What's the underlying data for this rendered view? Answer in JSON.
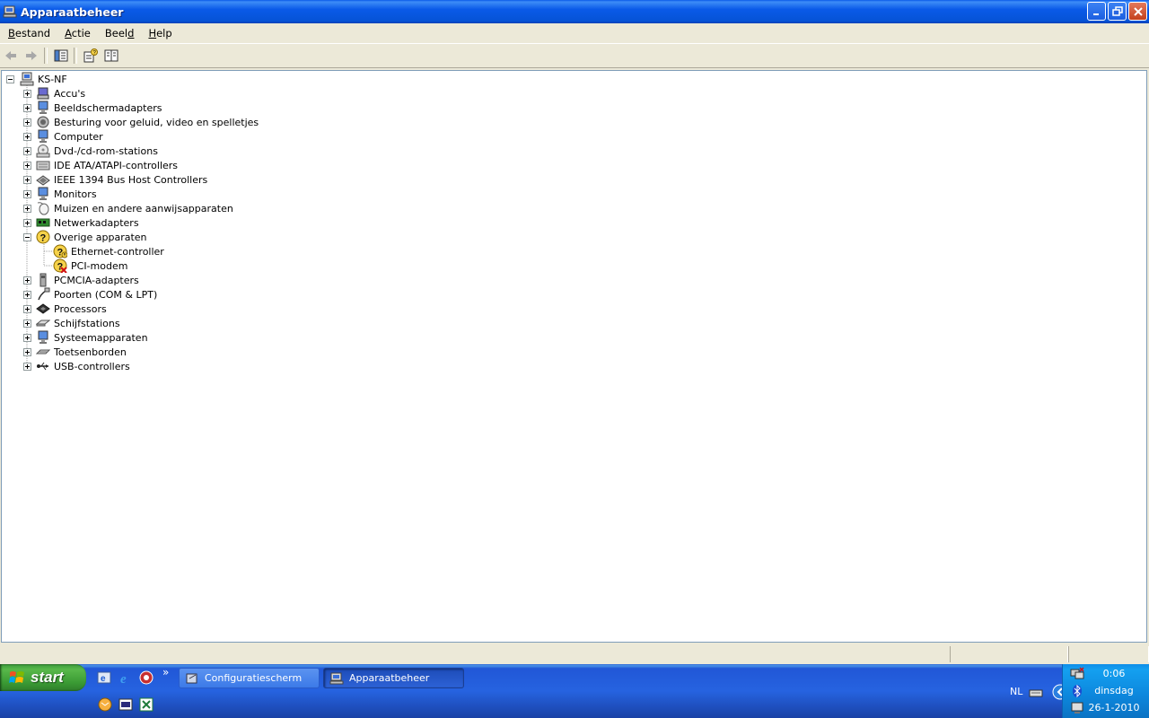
{
  "window": {
    "title": "Apparaatbeheer"
  },
  "menu": {
    "items": [
      {
        "label": "Bestand",
        "ul": "B",
        "rest": "estand"
      },
      {
        "label": "Actie",
        "ul": "A",
        "rest": "ctie"
      },
      {
        "label": "Beeld",
        "pre": "Beel",
        "ul": "d"
      },
      {
        "label": "Help",
        "ul": "H",
        "rest": "elp"
      }
    ]
  },
  "tree": {
    "root": "KS-NF",
    "categories": [
      {
        "label": "Accu's",
        "expanded": false
      },
      {
        "label": "Beeldschermadapters",
        "expanded": false
      },
      {
        "label": "Besturing voor geluid, video en spelletjes",
        "expanded": false
      },
      {
        "label": "Computer",
        "expanded": false
      },
      {
        "label": "Dvd-/cd-rom-stations",
        "expanded": false
      },
      {
        "label": "IDE ATA/ATAPI-controllers",
        "expanded": false
      },
      {
        "label": "IEEE 1394 Bus Host Controllers",
        "expanded": false
      },
      {
        "label": "Monitors",
        "expanded": false
      },
      {
        "label": "Muizen en andere aanwijsapparaten",
        "expanded": false
      },
      {
        "label": "Netwerkadapters",
        "expanded": false
      },
      {
        "label": "Overige apparaten",
        "expanded": true
      },
      {
        "label": "Ethernet-controller",
        "child": true
      },
      {
        "label": "PCI-modem",
        "child": true
      },
      {
        "label": "PCMCIA-adapters",
        "expanded": false
      },
      {
        "label": "Poorten (COM & LPT)",
        "expanded": false
      },
      {
        "label": "Processors",
        "expanded": false
      },
      {
        "label": "Schijfstations",
        "expanded": false
      },
      {
        "label": "Systeemapparaten",
        "expanded": false
      },
      {
        "label": "Toetsenborden",
        "expanded": false
      },
      {
        "label": "USB-controllers",
        "expanded": false
      }
    ]
  },
  "taskbar": {
    "start_label": "start",
    "buttons": [
      {
        "label": "Configuratiescherm",
        "active": false
      },
      {
        "label": "Apparaatbeheer",
        "active": true
      }
    ],
    "chevron": "»",
    "tray": {
      "language": "NL",
      "time": "0:06",
      "day": "dinsdag",
      "date": "26-1-2010"
    }
  },
  "colors": {
    "titlebar": "#0a5ae8",
    "taskbar": "#2663e0",
    "start": "#3a9a34",
    "tray": "#0c86dc"
  }
}
